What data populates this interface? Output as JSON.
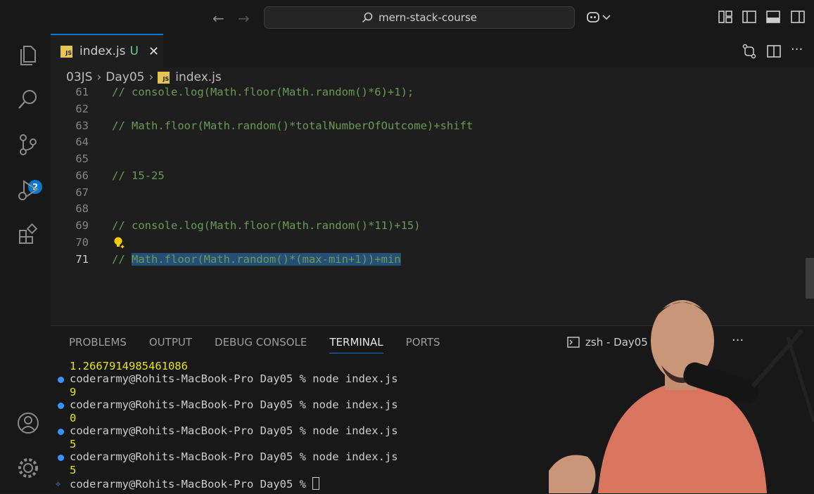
{
  "titlebar": {
    "search_text": "mern-stack-course"
  },
  "activity": {
    "scm_badge": "2"
  },
  "tab": {
    "filename": "index.js",
    "status": "U",
    "icon": "JS",
    "close": "✕"
  },
  "breadcrumb": {
    "folder1": "03JS",
    "folder2": "Day05",
    "file": "index.js"
  },
  "editor": {
    "lines": [
      {
        "num": "61",
        "text": "// console.log(Math.floor(Math.random()*6)+1);"
      },
      {
        "num": "62",
        "text": ""
      },
      {
        "num": "63",
        "text": "// Math.floor(Math.random()*totalNumberOfOutcome)+shift"
      },
      {
        "num": "64",
        "text": ""
      },
      {
        "num": "65",
        "text": ""
      },
      {
        "num": "66",
        "text": "// 15-25"
      },
      {
        "num": "67",
        "text": ""
      },
      {
        "num": "68",
        "text": ""
      },
      {
        "num": "69",
        "text": "// console.log(Math.floor(Math.random()*11)+15)"
      },
      {
        "num": "70",
        "text": ""
      },
      {
        "num": "71",
        "text_prefix": "// ",
        "text_selected": "Math.floor(Math.random()*(max-min+1))+min"
      }
    ]
  },
  "panel": {
    "tabs": [
      "PROBLEMS",
      "OUTPUT",
      "DEBUG CONSOLE",
      "TERMINAL",
      "PORTS"
    ],
    "terminal_title": "zsh - Day05",
    "more": "···"
  },
  "terminal": {
    "lines": [
      {
        "text": "1.2667914985461086",
        "type": "out"
      },
      {
        "text": "coderarmy@Rohits-MacBook-Pro Day05 % node index.js",
        "type": "cmd"
      },
      {
        "text": "9",
        "type": "out"
      },
      {
        "text": "coderarmy@Rohits-MacBook-Pro Day05 % node index.js",
        "type": "cmd"
      },
      {
        "text": "0",
        "type": "out"
      },
      {
        "text": "coderarmy@Rohits-MacBook-Pro Day05 % node index.js",
        "type": "cmd"
      },
      {
        "text": "5",
        "type": "out"
      },
      {
        "text": "coderarmy@Rohits-MacBook-Pro Day05 % node index.js",
        "type": "cmd"
      },
      {
        "text": "5",
        "type": "out"
      },
      {
        "text": "coderarmy@Rohits-MacBook-Pro Day05 % ",
        "type": "prompt"
      }
    ]
  },
  "colors": {
    "accent": "#0078d4",
    "comment": "#6a9955",
    "selection": "#264f78",
    "output": "#e5e510"
  }
}
